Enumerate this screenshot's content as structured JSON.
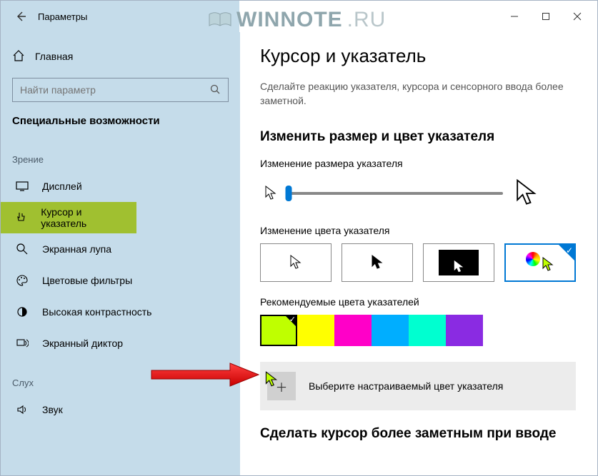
{
  "window": {
    "title": "Параметры"
  },
  "sidebar": {
    "home": "Главная",
    "search_placeholder": "Найти параметр",
    "section": "Специальные возможности",
    "groups": [
      {
        "label": "Зрение",
        "items": [
          {
            "label": "Дисплей",
            "selected": false
          },
          {
            "label": "Курсор и указатель",
            "selected": true
          },
          {
            "label": "Экранная лупа",
            "selected": false
          },
          {
            "label": "Цветовые фильтры",
            "selected": false
          },
          {
            "label": "Высокая контрастность",
            "selected": false
          },
          {
            "label": "Экранный диктор",
            "selected": false
          }
        ]
      },
      {
        "label": "Слух",
        "items": [
          {
            "label": "Звук",
            "selected": false
          }
        ]
      }
    ]
  },
  "main": {
    "title": "Курсор и указатель",
    "description": "Сделайте реакцию указателя, курсора и сенсорного ввода более заметной.",
    "size_section": "Изменить размер и цвет указателя",
    "size_label": "Изменение размера указателя",
    "color_label": "Изменение цвета указателя",
    "color_modes": [
      {
        "kind": "white",
        "selected": false
      },
      {
        "kind": "black",
        "selected": false
      },
      {
        "kind": "inverse",
        "selected": false
      },
      {
        "kind": "custom",
        "selected": true
      }
    ],
    "recommended_label": "Рекомендуемые цвета указателей",
    "recommended_colors": [
      {
        "hex": "#bfff00",
        "selected": true
      },
      {
        "hex": "#ffff00",
        "selected": false
      },
      {
        "hex": "#ff00c8",
        "selected": false
      },
      {
        "hex": "#00aeff",
        "selected": false
      },
      {
        "hex": "#00ffd0",
        "selected": false
      },
      {
        "hex": "#8a2be2",
        "selected": false
      }
    ],
    "custom_color_label": "Выберите настраиваемый цвет указателя",
    "bottom_section": "Сделать курсор более заметным при вводе"
  },
  "watermark": {
    "part1": "WINNOTE",
    "part2": ".RU"
  }
}
